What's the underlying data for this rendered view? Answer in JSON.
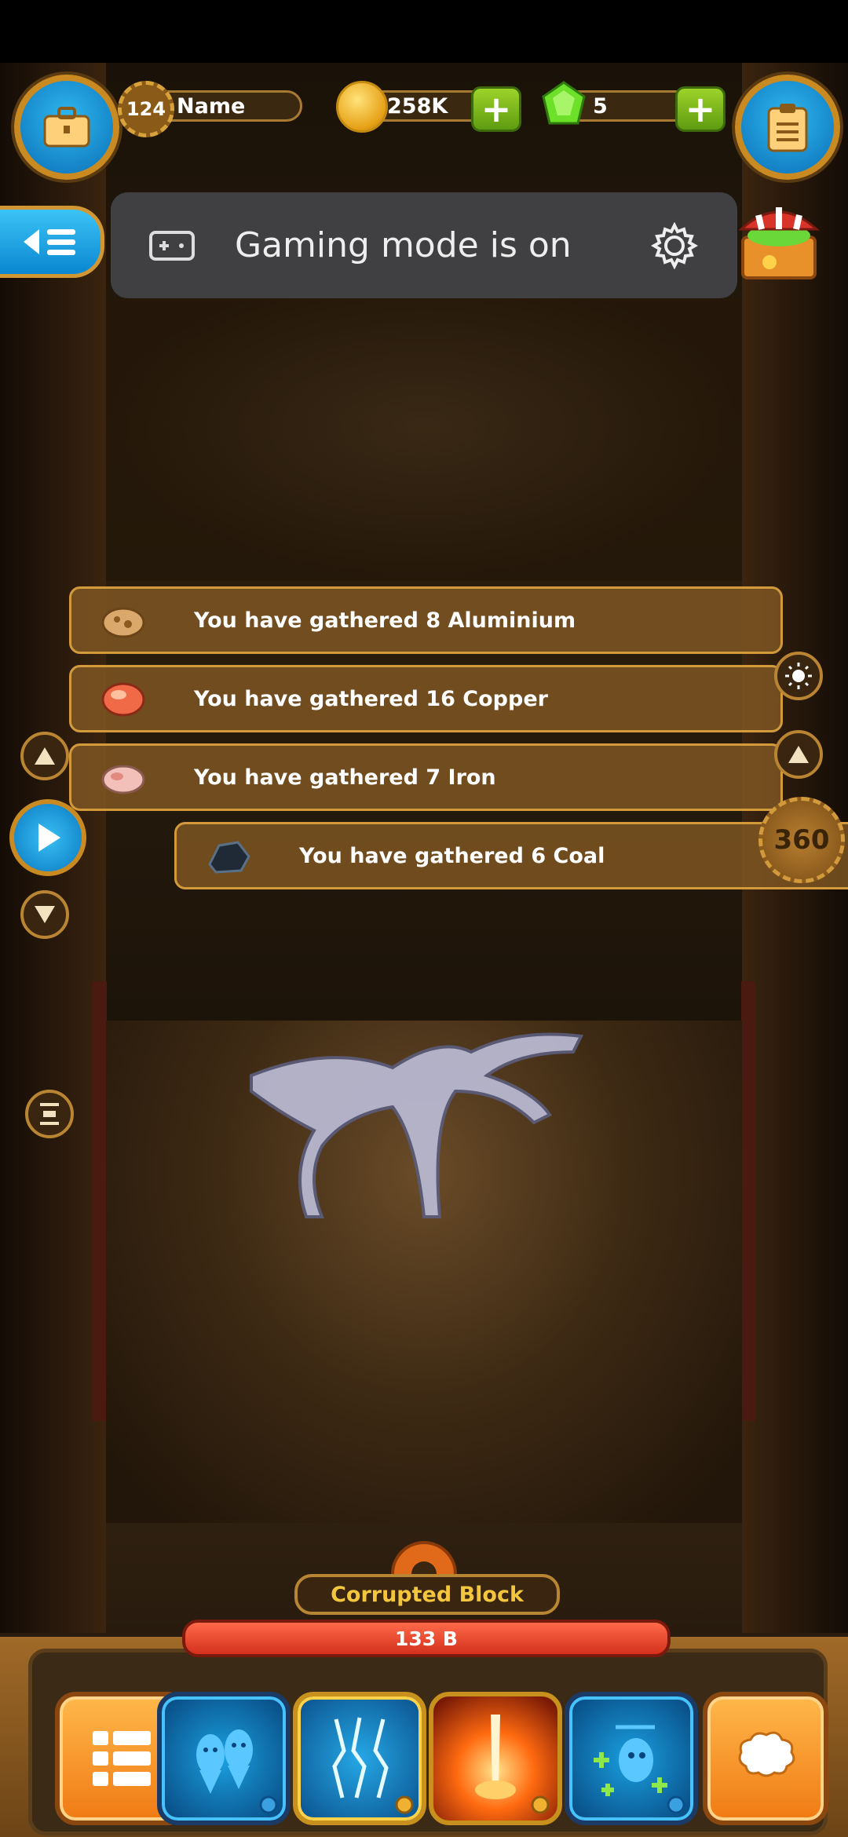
{
  "hud": {
    "level": "124",
    "player_name": "Name",
    "coins": "258K",
    "gems": "5",
    "plus_label": "+"
  },
  "toast": {
    "text": "Gaming mode is on"
  },
  "notifications": [
    {
      "text": "You have gathered 8 Aluminium",
      "ore": "aluminium-ore-icon"
    },
    {
      "text": "You have gathered 16 Copper",
      "ore": "copper-ore-icon"
    },
    {
      "text": "You have gathered 7 Iron",
      "ore": "iron-ore-icon"
    },
    {
      "text": "You have gathered 6 Coal",
      "ore": "coal-ore-icon"
    }
  ],
  "depth_badge": "360",
  "block": {
    "name": "Corrupted Block",
    "hp": "133 B"
  },
  "skills": [
    {
      "name": "menu-grid-skill"
    },
    {
      "name": "twin-drills-skill"
    },
    {
      "name": "lightning-skill"
    },
    {
      "name": "fire-beam-skill"
    },
    {
      "name": "heli-bot-skill"
    },
    {
      "name": "brain-skill"
    }
  ],
  "colors": {
    "accent_blue": "#0a87d0",
    "gold": "#d39a3c",
    "hp_red": "#d4311c",
    "label_yellow": "#f4c63e"
  }
}
